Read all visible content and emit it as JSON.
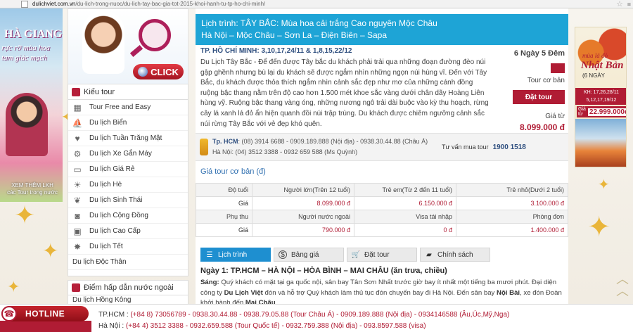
{
  "browser": {
    "url_host": "dulichviet.com.vn",
    "url_path": "/du-lich-trong-nuoc/du-lich-tay-bac-gia-tot-2015-khoi-hanh-tu-tp-ho-chi-minh/"
  },
  "left_banner": {
    "title": "HÀ GIANG",
    "line2": "rực rỡ mùa hoa",
    "line3": "tam giác mạch",
    "more_line1": "XEM THÊM LKH",
    "more_line2": "các Tour trong nước"
  },
  "call_banner": {
    "click_label": "CLICK"
  },
  "sidebar": {
    "heading": "Kiểu tour",
    "items": [
      {
        "label": "Tour Free and Easy",
        "icon": "building-icon"
      },
      {
        "label": "Du lịch Biển",
        "icon": "sailboat-icon"
      },
      {
        "label": "Du lịch Tuần Trăng Mật",
        "icon": "heart-icon"
      },
      {
        "label": "Du lịch Xe Gắn Máy",
        "icon": "motorbike-icon"
      },
      {
        "label": "Du lịch Giá Rẻ",
        "icon": "money-icon"
      },
      {
        "label": "Du lịch Hè",
        "icon": "sun-icon"
      },
      {
        "label": "Du lịch Sinh Thái",
        "icon": "leaf-icon"
      },
      {
        "label": "Du lịch Cộng Đồng",
        "icon": "camera-icon"
      },
      {
        "label": "Du lịch Cao Cấp",
        "icon": "suitcase-icon"
      },
      {
        "label": "Du lịch Tết",
        "icon": "lantern-icon"
      }
    ],
    "last_item": "Du lịch Độc Thân",
    "heading2": "Điểm hấp dẫn nước ngoài",
    "sub_item": "Du lịch Hồng Kông"
  },
  "tour": {
    "title_line1": "Lịch trình: TÂY BẮC: Mùa hoa cải trắng Cao nguyên Mộc Châu",
    "title_line2": "Hà Nội – Mộc Châu – Sơn La – Điện Biên – Sapa",
    "departure": "TP. HỒ CHÍ MINH: 3,10,17,24/11 & 1,8,15,22/12",
    "description": "Du Lịch Tây Bắc - Để đến được Tây bắc du khách phải trải qua những đoạn đường đèo núi gập ghềnh nhưng bù lại du khách sẽ được ngắm nhìn những ngọn núi hùng vĩ. Đến với Tây Bắc, du khách được thỏa thích ngắm nhìn cảnh sắc đẹp như mơ của những cánh đồng ruộng bậc thang nằm trên độ cao hơn 1.500 mét khoe sắc vàng dưới chân dãy Hoàng Liên hùng vỹ. Ruộng bậc thang vàng óng, những nương ngô trải dài buộc vào kỳ thu hoạch, rừng cây lá xanh lá đỏ ẩn hiện quanh đồi núi trập trùng. Du khách được chiêm ngưỡng cảnh sắc núi rừng Tây Bắc với vẻ đẹp khó quên.",
    "duration": "6 Ngày 5 Đêm",
    "base_tour": "Tour cơ bản",
    "book_label": "Đặt tour",
    "price_from": "Giá từ",
    "price": "8.099.000 đ"
  },
  "contact": {
    "hcm_label": "Tp. HCM",
    "hcm_phones": ": (08) 3914 6688 - 0909.189.888 (Nội địa) - 0938.30.44.88 (Châu Á)",
    "hn_label": "Hà Nội",
    "hn_phones": ": (04) 3512 3388 - 0932 659 588 (Ms Quỳnh)",
    "advice_label": "Tư vấn mua tour",
    "advice_phone": "1900 1518"
  },
  "price_table": {
    "title": "Giá tour cơ bản (đ)",
    "rows": [
      [
        "Độ tuổi",
        "Người lớn(Trên 12 tuổi)",
        "Trẻ em(Từ 2 đến 11 tuổi)",
        "Trẻ nhỏ(Dưới 2 tuổi)"
      ],
      [
        "Giá",
        "8.099.000 đ",
        "6.150.000 đ",
        "3.100.000 đ"
      ],
      [
        "Phụ thu",
        "Người nước ngoài",
        "Visa tái nhập",
        "Phòng đơn"
      ],
      [
        "Giá",
        "790.000 đ",
        "0 đ",
        "1.400.000 đ"
      ]
    ]
  },
  "tabs": [
    {
      "label": "Lịch trình",
      "icon": "list-icon"
    },
    {
      "label": "Bảng giá",
      "icon": "dollar-icon"
    },
    {
      "label": "Đặt tour",
      "icon": "cart-icon"
    },
    {
      "label": "Chính sách",
      "icon": "chat-icon"
    }
  ],
  "itinerary": {
    "day1_title": "Ngày 1: TP.HCM – HÀ NỘI – HÒA BÌNH – MAI CHÂU (ăn trưa, chiều)",
    "morning_label": "Sáng:",
    "text_part1": " Quý khách có mặt tại ga quốc nội, sân bay Tân Sơn Nhất trước giờ bay ít nhất một tiếng ba mươi phút. Đại diện công ty ",
    "company": "Du Lịch Việt",
    "text_part2": " đón và hỗ trợ Quý khách làm thủ tục đón chuyến bay đi Hà Nội. Đến sân bay ",
    "airport": "Nội Bài",
    "text_part3": ", xe đón Đoàn khởi hành đến ",
    "destination": "Mai Châu"
  },
  "right_banner": {
    "line1": "mùa lá đỏ",
    "line2": "Nhật Bản",
    "line3": "(6 NGÀY",
    "kh1": "KH: 17,26,28/11",
    "kh2": "5,12,17,19/12",
    "price_label": "Giá từ",
    "price": "22.999.000đ"
  },
  "hotline": {
    "label": "HOTLINE",
    "hcm_prefix": "TP.HCM : ",
    "hcm_text": "(+84 8) 73056789 - 0938.30.44.88 - 0938.79.05.88 (Tour Châu Á) - 0909.189.888 (Nội địa) - 0934146588 (Âu,Úc,Mỹ,Nga)",
    "hn_prefix": "Hà Nội : ",
    "hn_text": "(+84 4) 3512 3388 - 0932.659.588 (Tour Quốc tế) - 0932.759.388 (Nội địa) - 093.8597.588 (visa)"
  },
  "colors": {
    "accent_blue": "#1ea4d6",
    "brand_red": "#b01c34",
    "link_blue": "#2f6fb0"
  }
}
